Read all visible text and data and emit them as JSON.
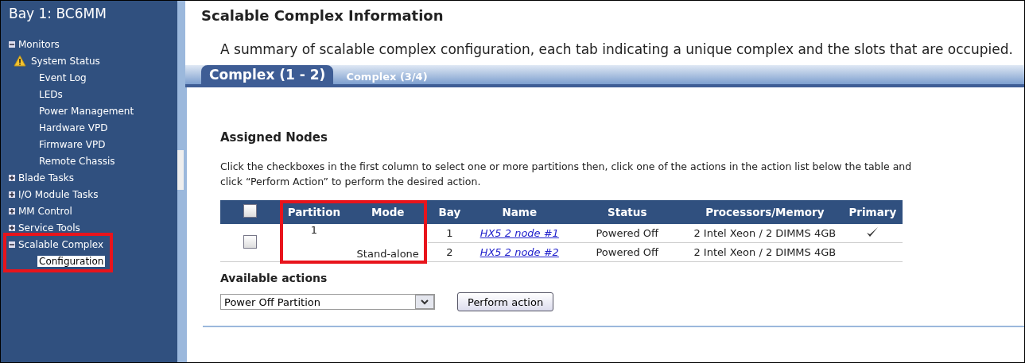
{
  "sidebar": {
    "title": "Bay 1: BC6MM",
    "groups": [
      {
        "label": "Monitors",
        "expanded": true,
        "highlighted": false,
        "children": [
          {
            "label": "System Status",
            "warning": true,
            "selected": false
          },
          {
            "label": "Event Log",
            "warning": false,
            "selected": false
          },
          {
            "label": "LEDs",
            "warning": false,
            "selected": false
          },
          {
            "label": "Power Management",
            "warning": false,
            "selected": false
          },
          {
            "label": "Hardware VPD",
            "warning": false,
            "selected": false
          },
          {
            "label": "Firmware VPD",
            "warning": false,
            "selected": false
          },
          {
            "label": "Remote Chassis",
            "warning": false,
            "selected": false
          }
        ]
      },
      {
        "label": "Blade Tasks",
        "expanded": false,
        "highlighted": false
      },
      {
        "label": "I/O Module Tasks",
        "expanded": false,
        "highlighted": false
      },
      {
        "label": "MM Control",
        "expanded": false,
        "highlighted": false
      },
      {
        "label": "Service Tools",
        "expanded": false,
        "highlighted": false
      },
      {
        "label": "Scalable Complex",
        "expanded": true,
        "highlighted": true,
        "children": [
          {
            "label": "Configuration",
            "warning": false,
            "selected": true
          }
        ]
      }
    ]
  },
  "page": {
    "title": "Scalable Complex Information",
    "description": "A summary of scalable complex configuration, each tab indicating a unique complex and the slots that are occupied."
  },
  "tabs": [
    {
      "label": "Complex (1 - 2)",
      "selected": true
    },
    {
      "label": "Complex (3/4)",
      "selected": false
    }
  ],
  "section": {
    "title": "Assigned Nodes",
    "instructions": "Click the checkboxes in the first column to select one or more partitions then, click one of the actions in the action list below the table and click “Perform Action” to perform the desired action."
  },
  "table": {
    "select_all_checked": false,
    "columns": [
      {
        "label": "Partition",
        "highlighted": true
      },
      {
        "label": "Mode",
        "highlighted": true
      },
      {
        "label": "Bay",
        "highlighted": false
      },
      {
        "label": "Name",
        "highlighted": false
      },
      {
        "label": "Status",
        "highlighted": false
      },
      {
        "label": "Processors/Memory",
        "highlighted": false
      },
      {
        "label": "Primary",
        "highlighted": false
      }
    ],
    "partitions": [
      {
        "checked": false,
        "partition": "1",
        "mode": "Stand-alone",
        "nodes": [
          {
            "bay": "1",
            "name": "HX5 2 node #1",
            "status": "Powered Off",
            "processors_memory": "2 Intel Xeon / 2 DIMMS 4GB",
            "primary": true
          },
          {
            "bay": "2",
            "name": "HX5 2 node #2",
            "status": "Powered Off",
            "processors_memory": "2 Intel Xeon / 2 DIMMS 4GB",
            "primary": false
          }
        ]
      }
    ]
  },
  "actions": {
    "label": "Available actions",
    "selected": "Power Off Partition",
    "button": "Perform action"
  }
}
